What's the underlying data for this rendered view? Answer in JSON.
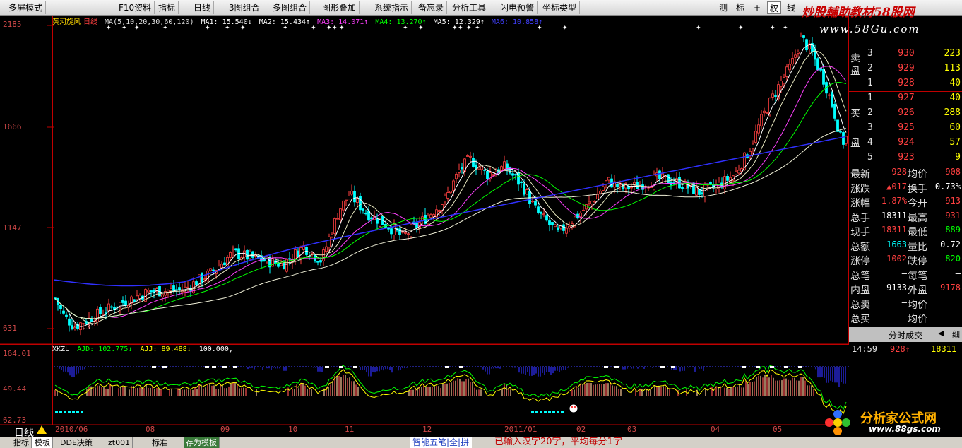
{
  "menubar": {
    "items": [
      "多屏模式",
      "F10资料",
      "指标",
      "日线",
      "3图组合",
      "多图组合",
      "图形叠加",
      "系统指示",
      "备忘录",
      "分析工具",
      "闪电预警",
      "坐标类型"
    ],
    "modes": [
      "测",
      "标",
      "+",
      "权",
      "线"
    ],
    "active_mode_index": 3
  },
  "brand": {
    "title": "炒股輔助教材58股网",
    "url": "www.58Gu.com"
  },
  "main_chart": {
    "stock_name": "黄河旋风",
    "period": "日线",
    "ma_params": "MA(5,10,20,30,60,120)",
    "ma_legend": [
      {
        "label": "MA1: 15.540↓",
        "color": "#ffffff"
      },
      {
        "label": "MA2: 15.434↑",
        "color": "#ffffff"
      },
      {
        "label": "MA3: 14.071↑",
        "color": "#ff40ff"
      },
      {
        "label": "MA4: 13.270↑",
        "color": "#00ff00"
      },
      {
        "label": "MA5: 12.329↑",
        "color": "#ffffff"
      },
      {
        "label": "MA6: 10.858↑",
        "color": "#4040ff"
      }
    ],
    "y_labels": [
      "2185",
      "1666",
      "1147",
      "631"
    ],
    "low_marker": "6.31"
  },
  "indicator": {
    "name": "XKZL",
    "legend": [
      {
        "label": "AJD: 102.775↓",
        "color": "#00ff00"
      },
      {
        "label": "AJJ: 89.488↓",
        "color": "#ffff00"
      },
      {
        "label": "100.000,",
        "color": "#ffffff"
      }
    ],
    "y_labels": [
      "164.01",
      "49.44",
      "62.73"
    ]
  },
  "x_axis": {
    "labels": [
      "2010/06",
      "08",
      "09",
      "10",
      "11",
      "12",
      "2011/01",
      "02",
      "03",
      "04",
      "05"
    ]
  },
  "bottom_tabs": [
    "指标",
    "模板",
    "DDE决策",
    "zt001",
    "标准",
    "存为模板"
  ],
  "ime": {
    "bar": "智能五笔|全|拼",
    "status": "已输入汉字20字，平均每分1字"
  },
  "order_book": {
    "sell_label_top": "卖",
    "sell_label_bottom": "盘",
    "buy_label_top": "买",
    "buy_label_bottom": "盘",
    "sell": [
      {
        "level": "3",
        "price": "930",
        "volume": "223"
      },
      {
        "level": "2",
        "price": "929",
        "volume": "113"
      },
      {
        "level": "1",
        "price": "928",
        "volume": "40"
      }
    ],
    "buy": [
      {
        "level": "1",
        "price": "927",
        "volume": "40"
      },
      {
        "level": "2",
        "price": "926",
        "volume": "288"
      },
      {
        "level": "3",
        "price": "925",
        "volume": "60"
      },
      {
        "level": "4",
        "price": "924",
        "volume": "57"
      },
      {
        "level": "5",
        "price": "923",
        "volume": "9"
      }
    ]
  },
  "stats": [
    {
      "l1": "最新",
      "v1": "928",
      "c1": "#ff4040",
      "l2": "均价",
      "v2": "908",
      "c2": "#ff4040"
    },
    {
      "l1": "涨跌",
      "v1": "▲017",
      "c1": "#ff4040",
      "l2": "换手",
      "v2": "0.73%",
      "c2": "#ffffff"
    },
    {
      "l1": "涨幅",
      "v1": "1.87%",
      "c1": "#ff4040",
      "l2": "今开",
      "v2": "913",
      "c2": "#ff4040"
    },
    {
      "l1": "总手",
      "v1": "18311",
      "c1": "#ffffff",
      "l2": "最高",
      "v2": "931",
      "c2": "#ff4040"
    },
    {
      "l1": "现手",
      "v1": "18311",
      "c1": "#ff4040",
      "l2": "最低",
      "v2": "889",
      "c2": "#00ff00"
    },
    {
      "l1": "总额",
      "v1": "1663",
      "c1": "#00ffff",
      "l2": "量比",
      "v2": "0.72",
      "c2": "#ffffff"
    },
    {
      "l1": "涨停",
      "v1": "1002",
      "c1": "#ff4040",
      "l2": "跌停",
      "v2": "820",
      "c2": "#00ff00"
    },
    {
      "l1": "总笔",
      "v1": "—",
      "c1": "#ffffff",
      "l2": "每笔",
      "v2": "—",
      "c2": "#ffffff"
    },
    {
      "l1": "内盘",
      "v1": "9133",
      "c1": "#ffffff",
      "l2": "外盘",
      "v2": "9178",
      "c2": "#ff4040"
    },
    {
      "l1": "总卖",
      "v1": "—",
      "c1": "#ffffff",
      "l2": "均价",
      "v2": "",
      "c2": "#ffffff"
    },
    {
      "l1": "总买",
      "v1": "—",
      "c1": "#ffffff",
      "l2": "均价",
      "v2": "",
      "c2": "#ffffff"
    }
  ],
  "ticks": {
    "header": "分时成交",
    "side_label": "细",
    "rows": [
      {
        "time": "14:59",
        "price": "928↑",
        "volume": "18311"
      }
    ]
  },
  "logo": {
    "title": "分析家公式网",
    "url": "www.88gs.com"
  },
  "chart_data": {
    "type": "candlestick",
    "title": "黄河旋风 日线",
    "y_range": [
      6.31,
      21.85
    ],
    "ma_periods": [
      5,
      10,
      20,
      30,
      60,
      120
    ],
    "x": [
      "2010/06",
      "08",
      "09",
      "10",
      "11",
      "12",
      "2011/01",
      "02",
      "03",
      "04",
      "05"
    ],
    "close_approx": [
      6.8,
      7.8,
      9.2,
      10.5,
      12.8,
      14.6,
      11.6,
      13.4,
      14.5,
      15.2,
      20.5,
      16.0
    ],
    "indicator_series": [
      {
        "name": "AJD",
        "last": 102.775
      },
      {
        "name": "AJJ",
        "last": 89.488
      },
      {
        "name": "LINE",
        "last": 100.0
      }
    ]
  },
  "colors": {
    "up": "#ff4040",
    "down": "#00ffff",
    "axis": "#c00000",
    "ma_blue": "#3030ff",
    "ma_green": "#00ff00",
    "ma_magenta": "#ff40ff",
    "ma_white": "#ffffff"
  }
}
